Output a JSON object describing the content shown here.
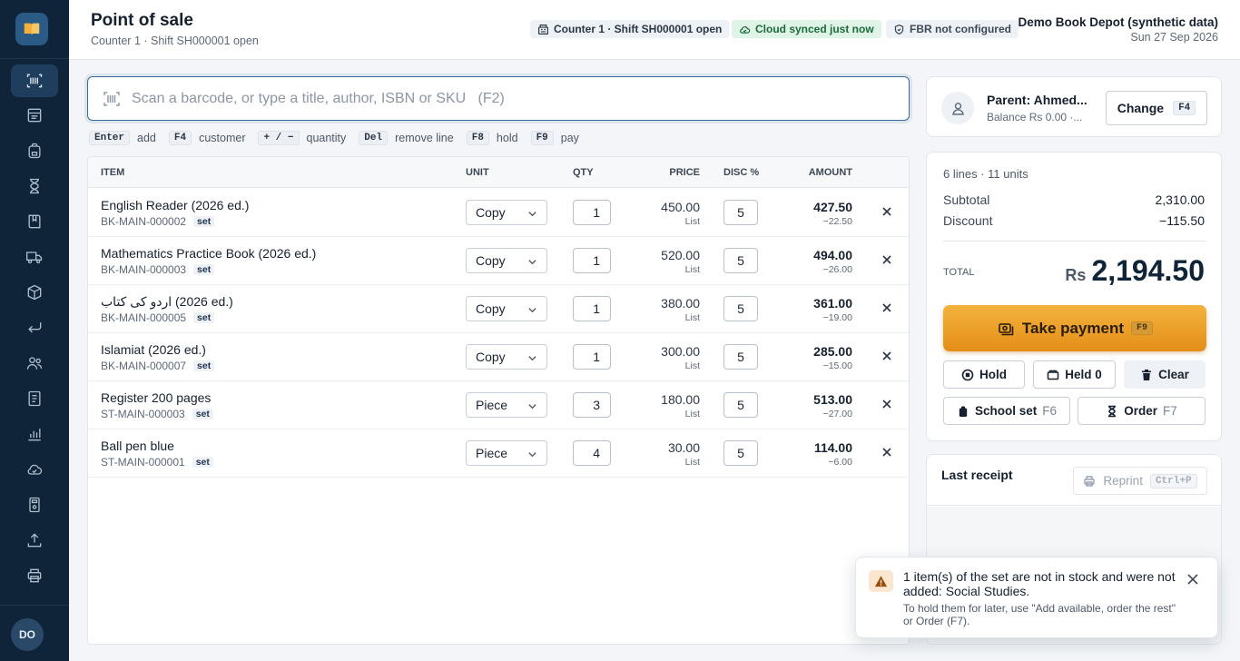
{
  "sidebar": {
    "logo_icon": "book-icon",
    "items": [
      {
        "icon": "barcode-scanner-icon",
        "active": true
      },
      {
        "icon": "catalog-icon"
      },
      {
        "icon": "school-bag-icon"
      },
      {
        "icon": "hourglass-icon"
      },
      {
        "icon": "bookmark-book-icon"
      },
      {
        "icon": "truck-icon"
      },
      {
        "icon": "box-icon"
      },
      {
        "icon": "return-arrow-icon"
      },
      {
        "icon": "users-icon"
      },
      {
        "icon": "ledger-icon"
      },
      {
        "icon": "bar-chart-icon"
      },
      {
        "icon": "cloud-icon"
      },
      {
        "icon": "calculator-icon"
      },
      {
        "icon": "upload-icon"
      },
      {
        "icon": "printer-icon"
      }
    ],
    "avatar_initials": "DO"
  },
  "header": {
    "title": "Point of sale",
    "subtitle": "Counter 1 · Shift SH000001 open",
    "badges": {
      "counter": "Counter 1 · Shift SH000001 open",
      "cloud": "Cloud synced just now",
      "fbr": "FBR not configured"
    },
    "store_name": "Demo Book Depot (synthetic data)",
    "date": "Sun 27 Sep 2026"
  },
  "search": {
    "placeholder": "Scan a barcode, or type a title, author, ISBN or SKU   (F2)",
    "value": ""
  },
  "shortcuts": [
    {
      "key": "Enter",
      "label": "add"
    },
    {
      "key": "F4",
      "label": "customer"
    },
    {
      "key": "+ / −",
      "label": "quantity"
    },
    {
      "key": "Del",
      "label": "remove line"
    },
    {
      "key": "F8",
      "label": "hold"
    },
    {
      "key": "F9",
      "label": "pay"
    }
  ],
  "table": {
    "columns": {
      "item": "ITEM",
      "unit": "UNIT",
      "qty": "QTY",
      "price": "PRICE",
      "disc": "DISC %",
      "amount": "AMOUNT"
    },
    "rows": [
      {
        "name": "English Reader (2026 ed.)",
        "sku": "BK-MAIN-000002",
        "tag": "set",
        "unit": "Copy",
        "qty": "1",
        "price": "450.00",
        "price_note": "List",
        "disc": "5",
        "amount": "427.50",
        "discount_amount": "−22.50"
      },
      {
        "name": "Mathematics Practice Book (2026 ed.)",
        "sku": "BK-MAIN-000003",
        "tag": "set",
        "unit": "Copy",
        "qty": "1",
        "price": "520.00",
        "price_note": "List",
        "disc": "5",
        "amount": "494.00",
        "discount_amount": "−26.00"
      },
      {
        "name": "اردو کی کتاب (2026 ed.)",
        "sku": "BK-MAIN-000005",
        "tag": "set",
        "unit": "Copy",
        "qty": "1",
        "price": "380.00",
        "price_note": "List",
        "disc": "5",
        "amount": "361.00",
        "discount_amount": "−19.00"
      },
      {
        "name": "Islamiat (2026 ed.)",
        "sku": "BK-MAIN-000007",
        "tag": "set",
        "unit": "Copy",
        "qty": "1",
        "price": "300.00",
        "price_note": "List",
        "disc": "5",
        "amount": "285.00",
        "discount_amount": "−15.00"
      },
      {
        "name": "Register 200 pages",
        "sku": "ST-MAIN-000003",
        "tag": "set",
        "unit": "Piece",
        "qty": "3",
        "price": "180.00",
        "price_note": "List",
        "disc": "5",
        "amount": "513.00",
        "discount_amount": "−27.00"
      },
      {
        "name": "Ball pen blue",
        "sku": "ST-MAIN-000001",
        "tag": "set",
        "unit": "Piece",
        "qty": "4",
        "price": "30.00",
        "price_note": "List",
        "disc": "5",
        "amount": "114.00",
        "discount_amount": "−6.00"
      }
    ]
  },
  "customer": {
    "name": "Parent: Ahmed...",
    "balance": "Balance Rs 0.00 ·...",
    "change_label": "Change",
    "change_key": "F4"
  },
  "totals": {
    "summary": "6 lines · 11 units",
    "subtotal_label": "Subtotal",
    "subtotal": "2,310.00",
    "discount_label": "Discount",
    "discount": "−115.50",
    "total_label": "TOTAL",
    "currency": "Rs",
    "total": "2,194.50"
  },
  "actions": {
    "pay_label": "Take payment",
    "pay_key": "F9",
    "hold_label": "Hold",
    "held_label": "Held 0",
    "clear_label": "Clear",
    "school_set_label": "School set",
    "school_set_key": "F6",
    "order_label": "Order",
    "order_key": "F7"
  },
  "receipt": {
    "title": "Last receipt",
    "reprint_label": "Reprint",
    "reprint_key": "Ctrl+P"
  },
  "toast": {
    "title": "1 item(s) of the set are not in stock and were not added: Social Studies.",
    "body": "To hold them for later, use \"Add available, order the rest\" or Order (F7)."
  },
  "colors": {
    "sidebar": "#0f2438",
    "accent": "#3b6c99",
    "pay_button": "#eea52c",
    "synced": "#1c6b3c",
    "warning": "#b9580e"
  }
}
